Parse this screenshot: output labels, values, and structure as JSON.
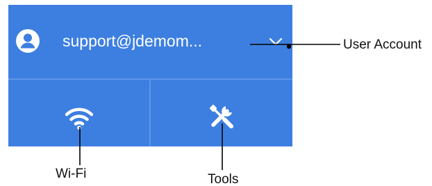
{
  "account": {
    "email": "support@jdemom...",
    "avatar_icon": "user-avatar-icon",
    "expand_icon": "chevron-down-icon"
  },
  "tiles": [
    {
      "id": "wifi",
      "icon": "wifi-icon"
    },
    {
      "id": "tools",
      "icon": "tools-icon"
    }
  ],
  "annotations": {
    "user_account": "User Account",
    "wifi": "Wi-Fi",
    "tools": "Tools"
  },
  "colors": {
    "panel_background": "#3d7fe0",
    "divider": "#5f96e8",
    "icon_foreground": "#ffffff",
    "annotation_text": "#111111"
  }
}
